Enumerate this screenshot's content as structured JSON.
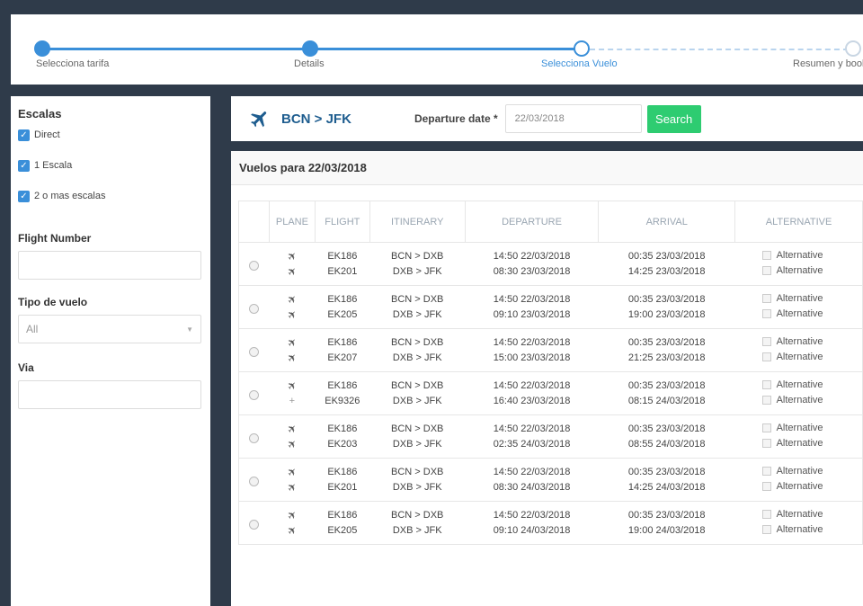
{
  "stepper": {
    "steps": [
      {
        "label": "Selecciona tarifa",
        "state": "done"
      },
      {
        "label": "Details",
        "state": "done"
      },
      {
        "label": "Selecciona Vuelo",
        "state": "current"
      },
      {
        "label": "Resumen y book",
        "state": "future"
      }
    ]
  },
  "sidebar": {
    "escalas_title": "Escalas",
    "escalas_options": [
      "Direct",
      "1 Escala",
      "2 o mas escalas"
    ],
    "flight_number_label": "Flight Number",
    "flight_number_value": "",
    "tipo_vuelo_label": "Tipo de vuelo",
    "tipo_vuelo_value": "All",
    "via_label": "Via",
    "via_value": ""
  },
  "search": {
    "route": "BCN > JFK",
    "departure_label": "Departure date *",
    "departure_value": "22/03/2018",
    "button": "Search"
  },
  "results": {
    "title": "Vuelos para 22/03/2018",
    "columns": [
      "PLANE",
      "FLIGHT",
      "ITINERARY",
      "DEPARTURE",
      "ARRIVAL",
      "ALTERNATIVE"
    ],
    "alt_label": "Alternative",
    "options": [
      [
        {
          "flight": "EK186",
          "itinerary": "BCN > DXB",
          "departure": "14:50 22/03/2018",
          "arrival": "00:35 23/03/2018"
        },
        {
          "flight": "EK201",
          "itinerary": "DXB > JFK",
          "departure": "08:30 23/03/2018",
          "arrival": "14:25 23/03/2018"
        }
      ],
      [
        {
          "flight": "EK186",
          "itinerary": "BCN > DXB",
          "departure": "14:50 22/03/2018",
          "arrival": "00:35 23/03/2018"
        },
        {
          "flight": "EK205",
          "itinerary": "DXB > JFK",
          "departure": "09:10 23/03/2018",
          "arrival": "19:00 23/03/2018"
        }
      ],
      [
        {
          "flight": "EK186",
          "itinerary": "BCN > DXB",
          "departure": "14:50 22/03/2018",
          "arrival": "00:35 23/03/2018"
        },
        {
          "flight": "EK207",
          "itinerary": "DXB > JFK",
          "departure": "15:00 23/03/2018",
          "arrival": "21:25 23/03/2018"
        }
      ],
      [
        {
          "flight": "EK186",
          "itinerary": "BCN > DXB",
          "departure": "14:50 22/03/2018",
          "arrival": "00:35 23/03/2018"
        },
        {
          "flight": "EK9326",
          "itinerary": "DXB > JFK",
          "departure": "16:40 23/03/2018",
          "arrival": "08:15 24/03/2018",
          "small_plane": true
        }
      ],
      [
        {
          "flight": "EK186",
          "itinerary": "BCN > DXB",
          "departure": "14:50 22/03/2018",
          "arrival": "00:35 23/03/2018"
        },
        {
          "flight": "EK203",
          "itinerary": "DXB > JFK",
          "departure": "02:35 24/03/2018",
          "arrival": "08:55 24/03/2018"
        }
      ],
      [
        {
          "flight": "EK186",
          "itinerary": "BCN > DXB",
          "departure": "14:50 22/03/2018",
          "arrival": "00:35 23/03/2018"
        },
        {
          "flight": "EK201",
          "itinerary": "DXB > JFK",
          "departure": "08:30 24/03/2018",
          "arrival": "14:25 24/03/2018"
        }
      ],
      [
        {
          "flight": "EK186",
          "itinerary": "BCN > DXB",
          "departure": "14:50 22/03/2018",
          "arrival": "00:35 23/03/2018"
        },
        {
          "flight": "EK205",
          "itinerary": "DXB > JFK",
          "departure": "09:10 24/03/2018",
          "arrival": "19:00 24/03/2018"
        }
      ]
    ]
  },
  "colors": {
    "accent": "#3a8fd9",
    "search_button": "#2ecc71",
    "frame": "#2f3b4a"
  }
}
